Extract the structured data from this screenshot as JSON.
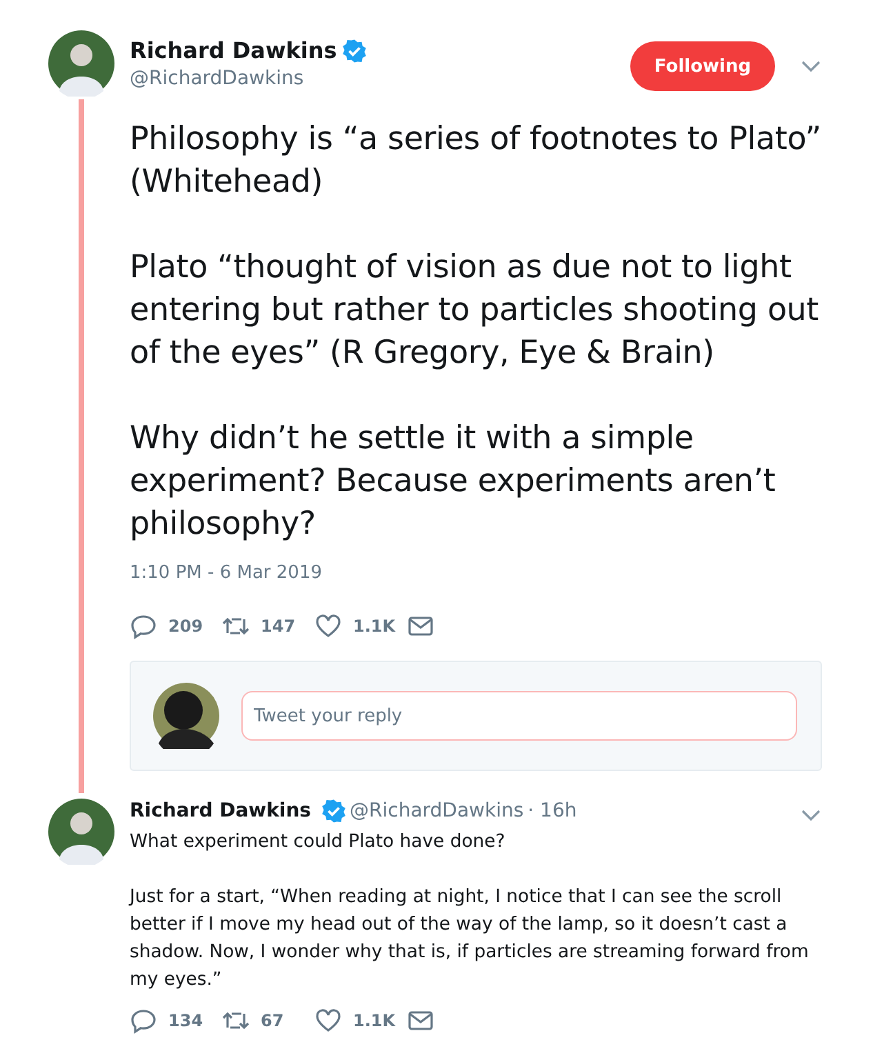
{
  "main_tweet": {
    "name": "Richard Dawkins",
    "verified": true,
    "handle": "@RichardDawkins",
    "follow_button": {
      "label": "Following",
      "selected": true
    },
    "paragraphs": [
      "Philosophy is “a series of footnotes to Plato” (Whitehead)",
      "Plato “thought of vision as due not to light entering but rather to particles shooting out of the eyes” (R Gregory, Eye & Brain)",
      "Why didn’t he settle it with a simple experiment? Because experiments aren’t philosophy?"
    ],
    "timestamp": "1:10 PM - 6 Mar 2019",
    "actions": [
      {
        "kind": "reply",
        "count": "209"
      },
      {
        "kind": "retweet",
        "count": "147"
      },
      {
        "kind": "like",
        "count": "1.1K"
      },
      {
        "kind": "message"
      }
    ]
  },
  "reply_box": {
    "placeholder": "Tweet your reply"
  },
  "reply_tweet": {
    "name": "Richard Dawkins",
    "verified": true,
    "handle": "@RichardDawkins",
    "time": "· 16h",
    "paragraphs": [
      "What experiment could Plato have done?",
      "Just for a start, “When reading at night, I notice that I can see the scroll better if I move my head out of the way of the lamp, so it doesn’t cast a shadow. Now, I wonder why that is, if particles are streaming forward from my eyes.”"
    ],
    "actions": [
      {
        "kind": "reply",
        "count": "134"
      },
      {
        "kind": "retweet",
        "count": "67"
      },
      {
        "kind": "like",
        "count": "1.1K"
      },
      {
        "kind": "message"
      }
    ]
  }
}
